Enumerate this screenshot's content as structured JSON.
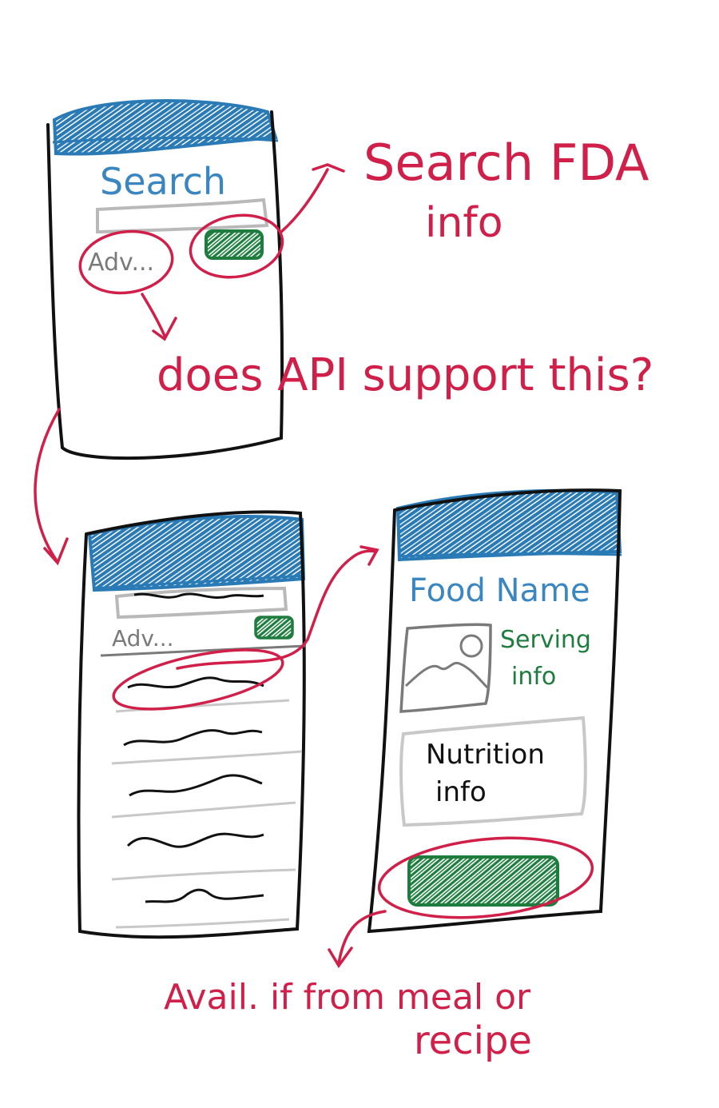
{
  "colors": {
    "ink": "#111111",
    "header_blue": "#2a7ab5",
    "title_blue": "#3a86c0",
    "annotation_red": "#d0204a",
    "button_green": "#1e7d3e",
    "gray": "#b9b9b9",
    "dark_gray": "#7a7a7a"
  },
  "search_screen": {
    "title": "Search",
    "advanced_label": "Adv..."
  },
  "results_screen": {
    "advanced_label": "Adv..."
  },
  "detail_screen": {
    "title": "Food Name",
    "serving_label_1": "Serving",
    "serving_label_2": "info",
    "nutrition_label_1": "Nutrition",
    "nutrition_label_2": "info"
  },
  "annotations": {
    "search_fda_1": "Search FDA",
    "search_fda_2": "info",
    "api_question": "does API support this?",
    "avail_1": "Avail. if from meal or",
    "avail_2": "recipe"
  }
}
